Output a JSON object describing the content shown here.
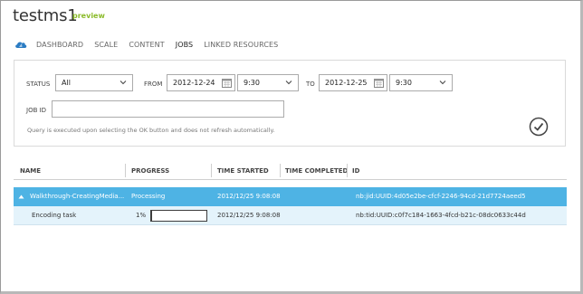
{
  "page": {
    "title": "testms1",
    "badge": "preview"
  },
  "nav": {
    "items": [
      "DASHBOARD",
      "SCALE",
      "CONTENT",
      "JOBS",
      "LINKED RESOURCES"
    ],
    "active": "JOBS"
  },
  "query": {
    "status_label": "STATUS",
    "status_value": "All",
    "from_label": "FROM",
    "from_date": "2012-12-24",
    "from_time": "9:30",
    "to_label": "TO",
    "to_date": "2012-12-25",
    "to_time": "9:30",
    "job_id_label": "JOB ID",
    "job_id_value": "",
    "note": "Query is executed upon selecting the OK button and does not refresh automatically."
  },
  "table": {
    "columns": [
      "NAME",
      "PROGRESS",
      "TIME STARTED",
      "TIME COMPLETED",
      "ID"
    ],
    "rows": [
      {
        "name": "Walkthrough-CreatingMedia...",
        "progress": "Processing",
        "time_started": "2012/12/25 9:08:08",
        "time_completed": "",
        "id": "nb:jid:UUID:4d05e2be-cfcf-2246-94cd-21d7724aeed5"
      },
      {
        "name": "Encoding task",
        "progress": "1%",
        "progress_fraction": 0.01,
        "time_started": "2012/12/25 9:08:08",
        "time_completed": "",
        "id": "nb:tid:UUID:c0f7c184-1663-4fcd-b21c-08dc0633c44d"
      }
    ]
  },
  "colors": {
    "accent": "#4eb3e4",
    "preview_green": "#8bbb2a",
    "task_row": "#e4f3fb"
  },
  "icons": {
    "nav": "cloud-service-icon",
    "calendar": "calendar-icon",
    "dropdown": "chevron-down-icon",
    "ok": "checkmark-circle-icon",
    "expand": "collapse-triangle-icon"
  }
}
